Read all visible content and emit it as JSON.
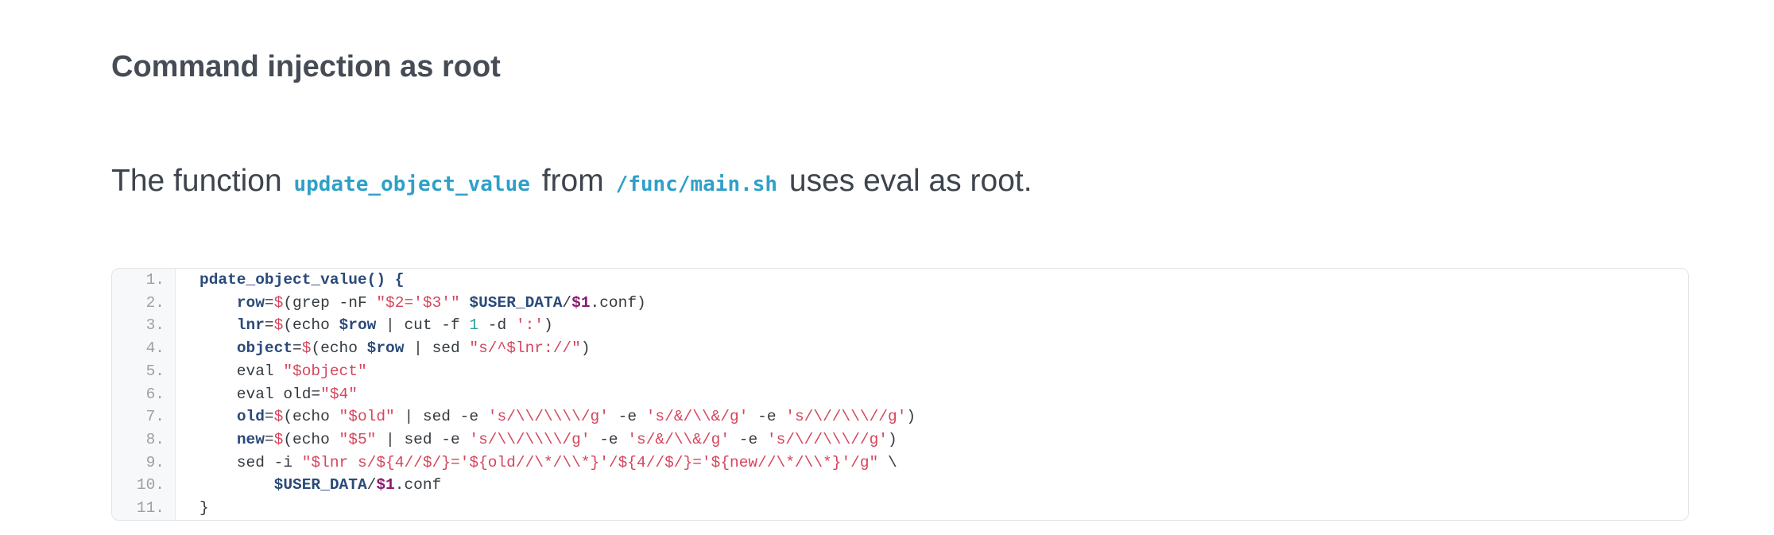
{
  "heading": "Command injection as root",
  "paragraph": {
    "before": "The function ",
    "code1": "update_object_value",
    "middle": " from ",
    "code2": "/func/main.sh",
    "after": " uses eval as root."
  },
  "code_block": {
    "lines": [
      {
        "num": "1.",
        "tokens": [
          {
            "t": "pdate_object_value() {",
            "c": "kw"
          }
        ]
      },
      {
        "num": "2.",
        "tokens": [
          {
            "t": "    ",
            "c": "plain"
          },
          {
            "t": "row",
            "c": "var"
          },
          {
            "t": "=",
            "c": "plain"
          },
          {
            "t": "$",
            "c": "dollar"
          },
          {
            "t": "(grep -nF ",
            "c": "plain"
          },
          {
            "t": "\"$2='$3'\"",
            "c": "str"
          },
          {
            "t": " ",
            "c": "plain"
          },
          {
            "t": "$USER_DATA",
            "c": "var"
          },
          {
            "t": "/",
            "c": "plain"
          },
          {
            "t": "$1",
            "c": "arg"
          },
          {
            "t": ".conf)",
            "c": "plain"
          }
        ]
      },
      {
        "num": "3.",
        "tokens": [
          {
            "t": "    ",
            "c": "plain"
          },
          {
            "t": "lnr",
            "c": "var"
          },
          {
            "t": "=",
            "c": "plain"
          },
          {
            "t": "$",
            "c": "dollar"
          },
          {
            "t": "(echo ",
            "c": "plain"
          },
          {
            "t": "$row",
            "c": "var"
          },
          {
            "t": " | cut -f ",
            "c": "plain"
          },
          {
            "t": "1",
            "c": "num"
          },
          {
            "t": " -d ",
            "c": "plain"
          },
          {
            "t": "':'",
            "c": "str"
          },
          {
            "t": ")",
            "c": "plain"
          }
        ]
      },
      {
        "num": "4.",
        "tokens": [
          {
            "t": "    ",
            "c": "plain"
          },
          {
            "t": "object",
            "c": "var"
          },
          {
            "t": "=",
            "c": "plain"
          },
          {
            "t": "$",
            "c": "dollar"
          },
          {
            "t": "(echo ",
            "c": "plain"
          },
          {
            "t": "$row",
            "c": "var"
          },
          {
            "t": " | sed ",
            "c": "plain"
          },
          {
            "t": "\"s/^$lnr://\"",
            "c": "str"
          },
          {
            "t": ")",
            "c": "plain"
          }
        ]
      },
      {
        "num": "5.",
        "tokens": [
          {
            "t": "    eval ",
            "c": "plain"
          },
          {
            "t": "\"$object\"",
            "c": "str"
          }
        ]
      },
      {
        "num": "6.",
        "tokens": [
          {
            "t": "    eval old=",
            "c": "plain"
          },
          {
            "t": "\"$4\"",
            "c": "str"
          }
        ]
      },
      {
        "num": "7.",
        "tokens": [
          {
            "t": "    ",
            "c": "plain"
          },
          {
            "t": "old",
            "c": "var"
          },
          {
            "t": "=",
            "c": "plain"
          },
          {
            "t": "$",
            "c": "dollar"
          },
          {
            "t": "(echo ",
            "c": "plain"
          },
          {
            "t": "\"$old\"",
            "c": "str"
          },
          {
            "t": " | sed -e ",
            "c": "plain"
          },
          {
            "t": "'s/\\\\/\\\\\\\\/g'",
            "c": "str"
          },
          {
            "t": " -e ",
            "c": "plain"
          },
          {
            "t": "'s/&/\\\\&/g'",
            "c": "str"
          },
          {
            "t": " -e ",
            "c": "plain"
          },
          {
            "t": "'s/\\//\\\\\\//g'",
            "c": "str"
          },
          {
            "t": ")",
            "c": "plain"
          }
        ]
      },
      {
        "num": "8.",
        "tokens": [
          {
            "t": "    ",
            "c": "plain"
          },
          {
            "t": "new",
            "c": "var"
          },
          {
            "t": "=",
            "c": "plain"
          },
          {
            "t": "$",
            "c": "dollar"
          },
          {
            "t": "(echo ",
            "c": "plain"
          },
          {
            "t": "\"$5\"",
            "c": "str"
          },
          {
            "t": " | sed -e ",
            "c": "plain"
          },
          {
            "t": "'s/\\\\/\\\\\\\\/g'",
            "c": "str"
          },
          {
            "t": " -e ",
            "c": "plain"
          },
          {
            "t": "'s/&/\\\\&/g'",
            "c": "str"
          },
          {
            "t": " -e ",
            "c": "plain"
          },
          {
            "t": "'s/\\//\\\\\\//g'",
            "c": "str"
          },
          {
            "t": ")",
            "c": "plain"
          }
        ]
      },
      {
        "num": "9.",
        "tokens": [
          {
            "t": "    sed -i ",
            "c": "plain"
          },
          {
            "t": "\"$lnr s/${4//$/}='${old//\\*/\\\\*}'/${4//$/}='${new//\\*/\\\\*}'/g\"",
            "c": "str"
          },
          {
            "t": " \\",
            "c": "plain"
          }
        ]
      },
      {
        "num": "10.",
        "tokens": [
          {
            "t": "        ",
            "c": "plain"
          },
          {
            "t": "$USER_DATA",
            "c": "var"
          },
          {
            "t": "/",
            "c": "plain"
          },
          {
            "t": "$1",
            "c": "arg"
          },
          {
            "t": ".conf",
            "c": "plain"
          }
        ]
      },
      {
        "num": "11.",
        "tokens": [
          {
            "t": "}",
            "c": "plain"
          }
        ]
      }
    ]
  }
}
